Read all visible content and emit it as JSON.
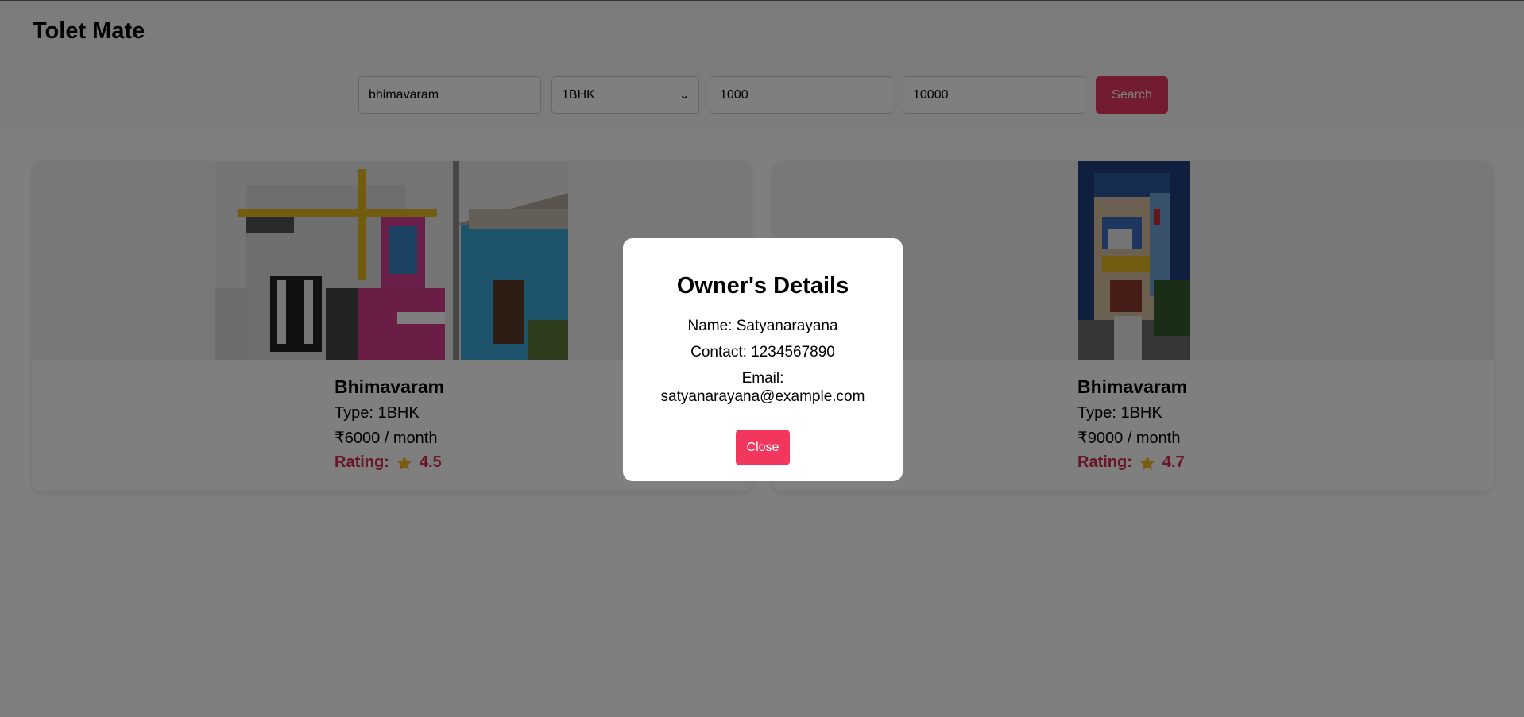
{
  "app": {
    "title": "Tolet Mate"
  },
  "search": {
    "location_value": "bhimavaram",
    "type_selected": "1BHK",
    "min_price_value": "1000",
    "max_price_value": "10000",
    "search_label": "Search"
  },
  "listings": [
    {
      "city": "Bhimavaram",
      "type": "Type: 1BHK",
      "price": "₹6000 / month",
      "rating_label": "Rating:",
      "rating": "4.5"
    },
    {
      "city": "Bhimavaram",
      "type": "Type: 1BHK",
      "price": "₹9000 / month",
      "rating_label": "Rating:",
      "rating": "4.7"
    }
  ],
  "modal": {
    "title": "Owner's Details",
    "name": "Name: Satyanarayana",
    "contact": "Contact: 1234567890",
    "email_label": "Email:",
    "email": "satyanarayana@example.com",
    "close_label": "Close"
  },
  "colors": {
    "accent": "#e8385e",
    "rating": "#d02a4e",
    "star": "#f5b820"
  }
}
